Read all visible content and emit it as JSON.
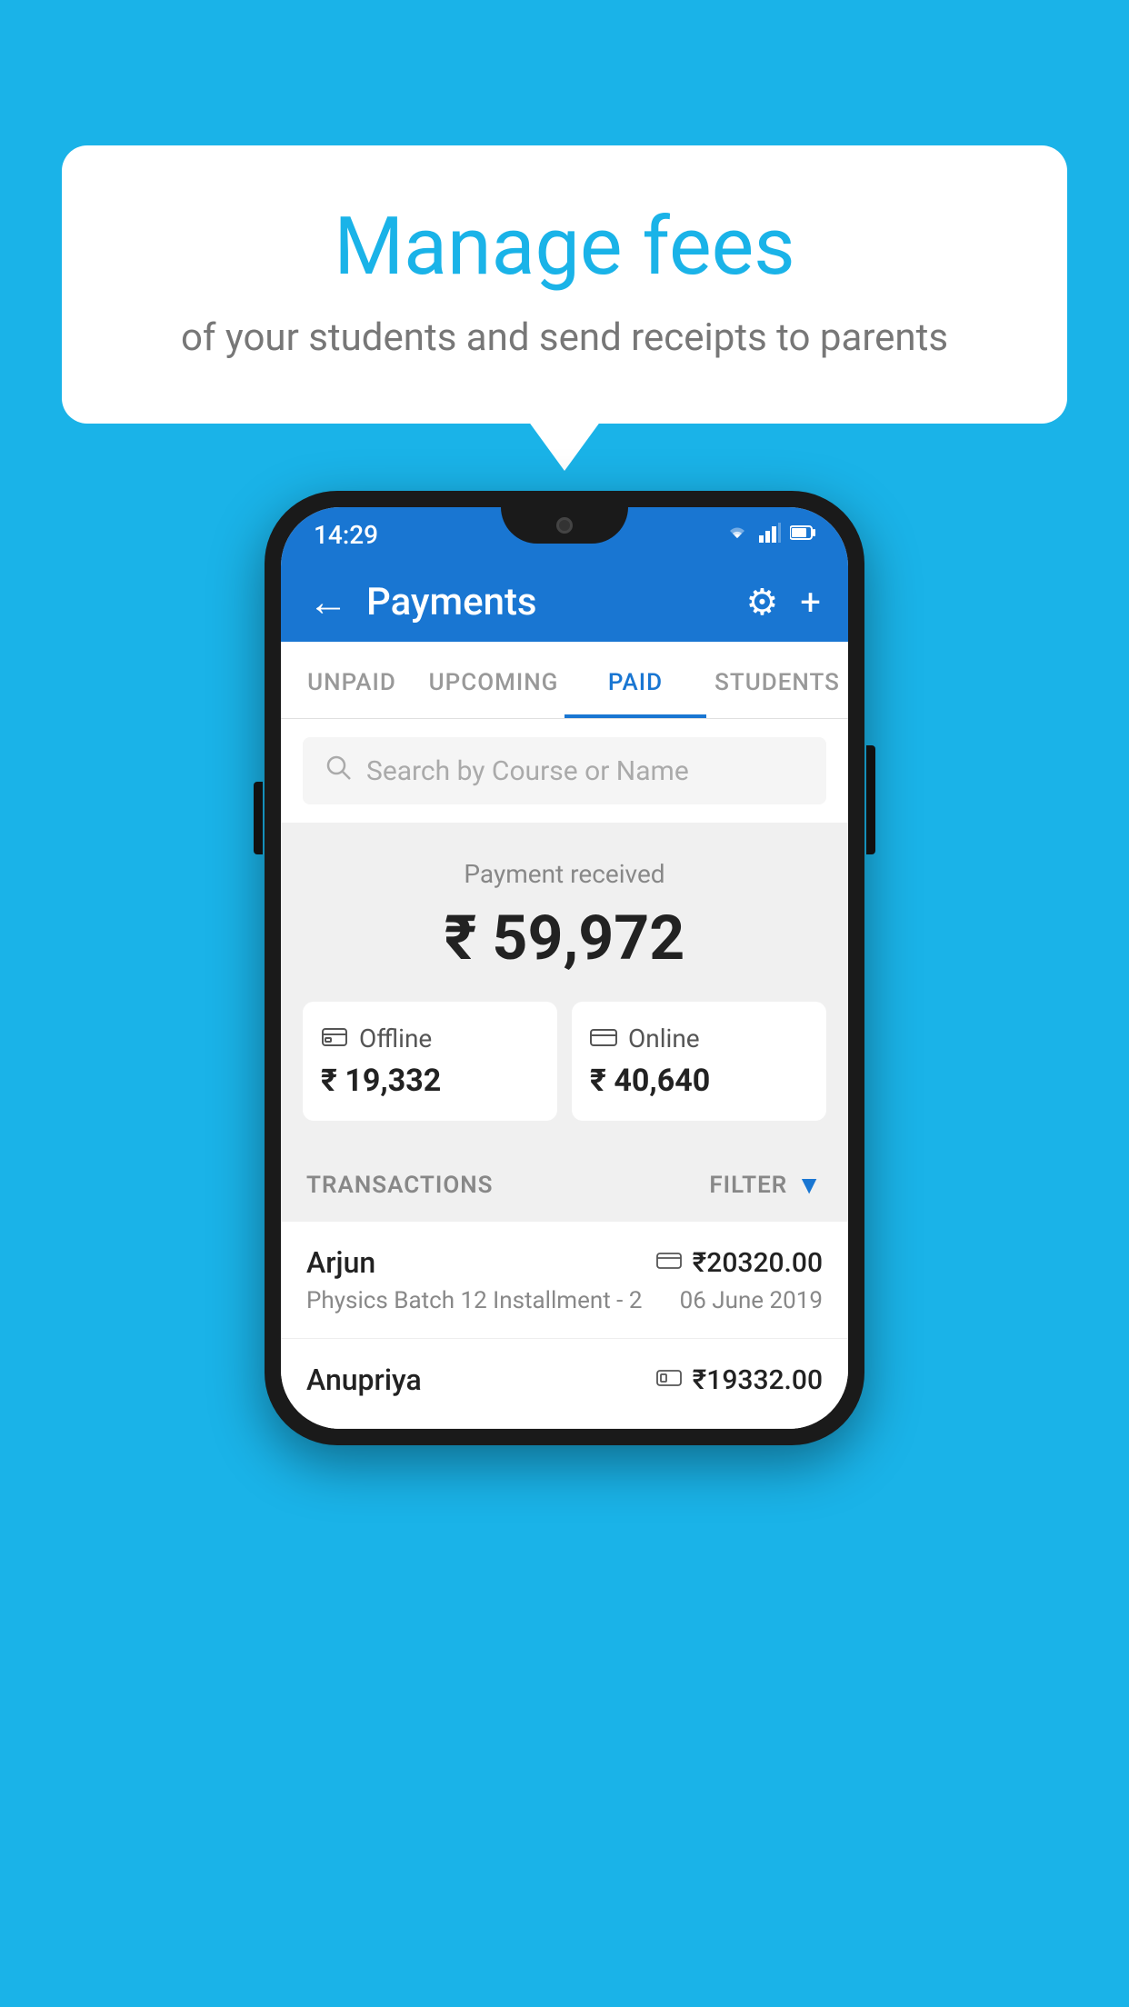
{
  "background_color": "#1ab3e8",
  "speech_bubble": {
    "title": "Manage fees",
    "subtitle": "of your students and send receipts to parents"
  },
  "status_bar": {
    "time": "14:29",
    "wifi": "▲",
    "signal": "▲",
    "battery": "▮"
  },
  "app_bar": {
    "title": "Payments",
    "back_label": "←",
    "gear_symbol": "⚙",
    "plus_symbol": "+"
  },
  "tabs": [
    {
      "label": "UNPAID",
      "active": false
    },
    {
      "label": "UPCOMING",
      "active": false
    },
    {
      "label": "PAID",
      "active": true
    },
    {
      "label": "STUDENTS",
      "active": false
    }
  ],
  "search": {
    "placeholder": "Search by Course or Name"
  },
  "payment_summary": {
    "label": "Payment received",
    "total_amount": "₹ 59,972",
    "offline": {
      "label": "Offline",
      "amount": "₹ 19,332"
    },
    "online": {
      "label": "Online",
      "amount": "₹ 40,640"
    }
  },
  "transactions": {
    "header_label": "TRANSACTIONS",
    "filter_label": "FILTER",
    "rows": [
      {
        "name": "Arjun",
        "course": "Physics Batch 12 Installment - 2",
        "amount": "₹20320.00",
        "date": "06 June 2019",
        "method": "card"
      },
      {
        "name": "Anupriya",
        "course": "",
        "amount": "₹19332.00",
        "date": "",
        "method": "cash"
      }
    ]
  }
}
